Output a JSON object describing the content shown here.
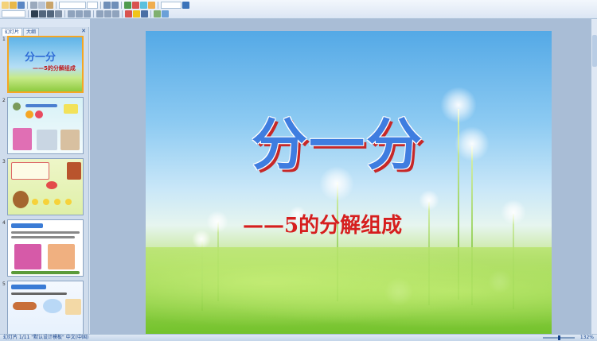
{
  "ribbon": {
    "row1_buttons": [
      "new-icon",
      "open-icon",
      "save-icon",
      "cut-icon",
      "copy-icon",
      "paste-icon",
      "undo-icon",
      "redo-icon",
      "print-icon",
      "preview-icon",
      "spell-icon",
      "table-icon",
      "chart-icon",
      "picture-icon",
      "shape-icon",
      "textbox-icon",
      "zoom-icon",
      "help-icon"
    ],
    "row2_buttons": [
      "bold-icon",
      "italic-icon",
      "underline-icon",
      "shadow-icon",
      "align-left-icon",
      "align-center-icon",
      "align-right-icon",
      "bullets-icon",
      "numbering-icon",
      "indent-icon",
      "font-color-icon",
      "fill-icon",
      "line-icon",
      "arrange-icon",
      "layout-icon",
      "design-icon",
      "animation-icon",
      "slideshow-icon"
    ]
  },
  "panel": {
    "tabs": [
      "幻灯片",
      "大纲"
    ],
    "close_icon": "✕",
    "slides": [
      {
        "num": "1",
        "title": "分一分",
        "subtitle": "——5的分解组成"
      },
      {
        "num": "2"
      },
      {
        "num": "3"
      },
      {
        "num": "4"
      },
      {
        "num": "5"
      }
    ]
  },
  "slide": {
    "title": "分一分",
    "subtitle": "——5的分解组成",
    "colors": {
      "title": "#3f7de0",
      "title_shadow": "#c62828",
      "subtitle": "#d61e1e"
    }
  },
  "status": {
    "left": "幻灯片 1/11   \"默认设计模板\"   中文(中国)",
    "zoom": "132%"
  }
}
